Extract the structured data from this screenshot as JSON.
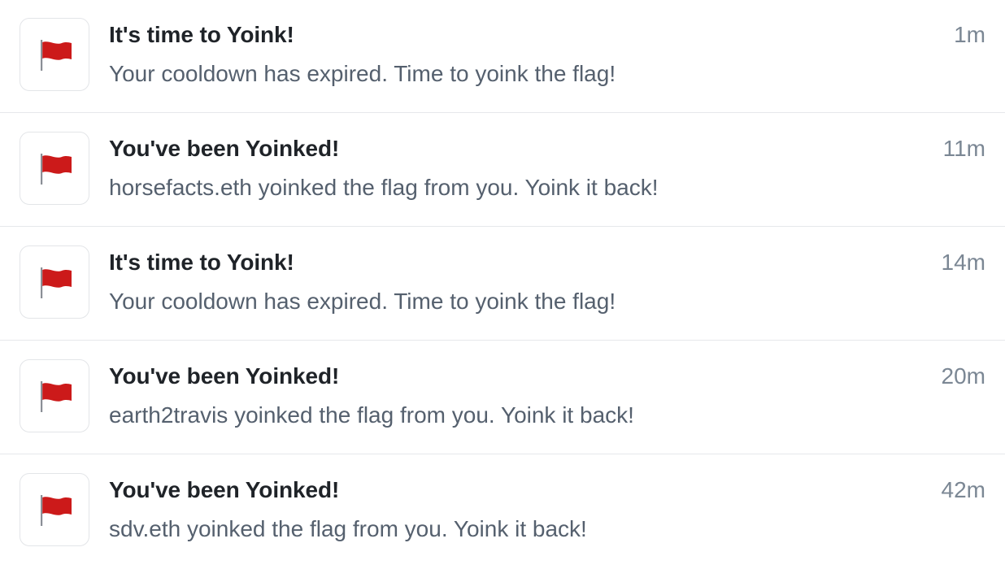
{
  "notifications": [
    {
      "icon": "red-flag-icon",
      "title": "It's time to Yoink!",
      "body": "Your cooldown has expired. Time to yoink the flag!",
      "time": "1m"
    },
    {
      "icon": "red-flag-icon",
      "title": "You've been Yoinked!",
      "body": "horsefacts.eth yoinked the flag from you. Yoink it back!",
      "time": "11m"
    },
    {
      "icon": "red-flag-icon",
      "title": "It's time to Yoink!",
      "body": "Your cooldown has expired. Time to yoink the flag!",
      "time": "14m"
    },
    {
      "icon": "red-flag-icon",
      "title": "You've been Yoinked!",
      "body": "earth2travis yoinked the flag from you. Yoink it back!",
      "time": "20m"
    },
    {
      "icon": "red-flag-icon",
      "title": "You've been Yoinked!",
      "body": "sdv.eth yoinked the flag from you. Yoink it back!",
      "time": "42m"
    }
  ],
  "colors": {
    "flag": "#cc1a1a",
    "pole": "#8a8f96",
    "title": "#1f2328",
    "body": "#55606e",
    "time": "#7b8794",
    "divider": "#e6e8eb"
  }
}
